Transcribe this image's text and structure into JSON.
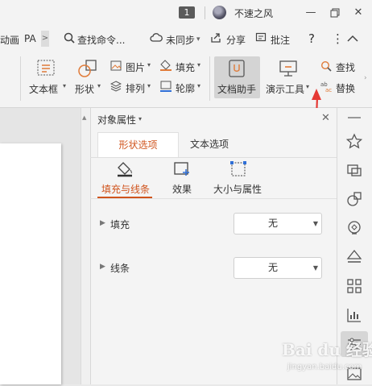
{
  "titlebar": {
    "window_number": "1",
    "user_name": "不速之风",
    "controls": [
      "minimize-icon",
      "restore-icon",
      "close-icon"
    ]
  },
  "menu": {
    "left_tabs": [
      "动画",
      "PA"
    ],
    "more_glyph": ">",
    "search_label": "查找命令...",
    "sync_label": "未同步",
    "share_label": "分享",
    "comment_label": "批注",
    "help_glyph": "?",
    "more_options_glyph": "⋮",
    "collapse_glyph": "^"
  },
  "ribbon": {
    "textbox_label": "文本框",
    "shape_label": "形状",
    "picture_label": "图片",
    "arrange_label": "排列",
    "fill_label": "填充",
    "outline_label": "轮廓",
    "doc_helper_label": "文档助手",
    "present_tools_label": "演示工具",
    "find_label": "查找",
    "replace_label": "替换"
  },
  "panel": {
    "title": "对象属性",
    "tabs": [
      {
        "label": "形状选项",
        "active": true
      },
      {
        "label": "文本选项",
        "active": false
      }
    ],
    "subtabs": [
      {
        "label": "填充与线条",
        "active": true,
        "icon": "fill-bucket-icon"
      },
      {
        "label": "效果",
        "active": false,
        "icon": "effect-icon"
      },
      {
        "label": "大小与属性",
        "active": false,
        "icon": "size-icon"
      }
    ],
    "properties": [
      {
        "label": "填充",
        "value": "无"
      },
      {
        "label": "线条",
        "value": "无"
      }
    ]
  },
  "sidebar_icons": [
    "star-icon",
    "swap-icon",
    "shapes-icon",
    "location-icon",
    "layers-icon",
    "grid-icon",
    "chart-icon",
    "settings-sliders-icon",
    "picture-icon"
  ],
  "watermark": {
    "text": "Bai du 经验",
    "sub": "jingyan.baidu.com"
  },
  "colors": {
    "accent": "#d0541d",
    "annotation_arrow": "#e53935"
  }
}
